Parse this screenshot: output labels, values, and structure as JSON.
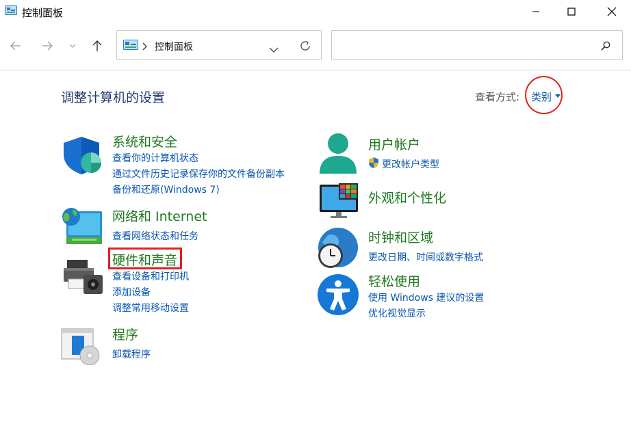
{
  "window": {
    "title": "控制面板"
  },
  "address": {
    "path": "控制面板"
  },
  "search": {
    "placeholder": ""
  },
  "main": {
    "title": "调整计算机的设置",
    "view_by_label": "查看方式:",
    "view_by_value": "类别"
  },
  "categories": {
    "system": {
      "title": "系统和安全",
      "links": [
        "查看你的计算机状态",
        "通过文件历史记录保存你的文件备份副本",
        "备份和还原(Windows 7)"
      ]
    },
    "network": {
      "title": "网络和 Internet",
      "links": [
        "查看网络状态和任务"
      ]
    },
    "hardware": {
      "title": "硬件和声音",
      "links": [
        "查看设备和打印机",
        "添加设备",
        "调整常用移动设置"
      ]
    },
    "programs": {
      "title": "程序",
      "links": [
        "卸载程序"
      ]
    },
    "users": {
      "title": "用户帐户",
      "links": [
        "更改帐户类型"
      ]
    },
    "appearance": {
      "title": "外观和个性化",
      "links": []
    },
    "clock": {
      "title": "时钟和区域",
      "links": [
        "更改日期、时间或数字格式"
      ]
    },
    "ease": {
      "title": "轻松使用",
      "links": [
        "使用 Windows 建议的设置",
        "优化视觉显示"
      ]
    }
  },
  "colors": {
    "category_title": "#1f7a1f",
    "link": "#0b56b0",
    "heading": "#1e3b6e",
    "annotation": "#e3201b"
  },
  "icons": [
    "control-panel-icon",
    "back-arrow-icon",
    "forward-arrow-icon",
    "chevron-down-icon",
    "up-arrow-icon",
    "refresh-icon",
    "search-icon",
    "shield-icon",
    "network-icon",
    "printer-icon",
    "programs-icon",
    "user-icon",
    "uac-shield-icon",
    "monitor-icon",
    "clock-icon",
    "accessibility-icon"
  ]
}
